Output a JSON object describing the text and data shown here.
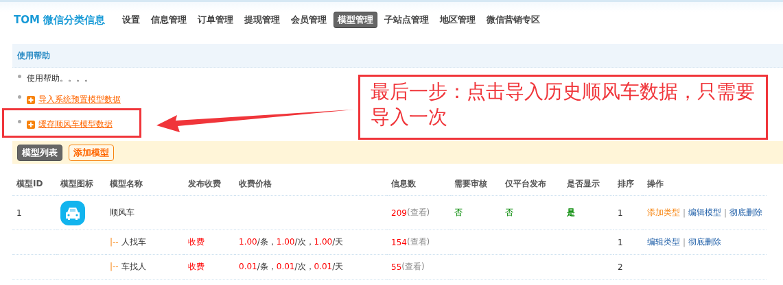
{
  "brand": "TOM 微信分类信息",
  "nav": [
    {
      "label": "设置",
      "selected": false
    },
    {
      "label": "信息管理",
      "selected": false
    },
    {
      "label": "订单管理",
      "selected": false
    },
    {
      "label": "提现管理",
      "selected": false
    },
    {
      "label": "会员管理",
      "selected": false
    },
    {
      "label": "模型管理",
      "selected": true
    },
    {
      "label": "子站点管理",
      "selected": false
    },
    {
      "label": "地区管理",
      "selected": false
    },
    {
      "label": "微信营销专区",
      "selected": false
    }
  ],
  "help": {
    "title": "使用帮助",
    "items": [
      {
        "kind": "text",
        "text": "使用帮助。。。。"
      },
      {
        "kind": "link",
        "text": "导入系统预置模型数据",
        "highlighted": false
      },
      {
        "kind": "link",
        "text": "缓存顺风车模型数据",
        "highlighted": true
      }
    ]
  },
  "annotation": {
    "text": "最后一步：点击导入历史顺风车数据，只需要导入一次"
  },
  "toolbar": [
    {
      "label": "模型列表",
      "selected": true
    },
    {
      "label": "添加模型",
      "selected": false
    }
  ],
  "table": {
    "columns": [
      "模型ID",
      "模型图标",
      "模型名称",
      "发布收费",
      "收费价格",
      "信息数",
      "需要审核",
      "仅平台发布",
      "是否显示",
      "排序",
      "操作"
    ],
    "rows": [
      {
        "kind": "model",
        "id": "1",
        "name": "顺风车",
        "action_separator": "|",
        "count": "209",
        "view": "(查看)",
        "review": "否",
        "platform_only": "否",
        "visible": "是",
        "sort": "1",
        "actions": [
          {
            "label": "添加类型",
            "kind": "add"
          },
          {
            "label": "编辑模型",
            "kind": "edit"
          },
          {
            "label": "彻底删除",
            "kind": "edit"
          }
        ]
      },
      {
        "kind": "type",
        "prefix": "|--",
        "name": "人找车",
        "action_separator": "|",
        "fee": "收费",
        "prices": [
          {
            "value": "1.00",
            "unit": "/条，"
          },
          {
            "value": "1.00",
            "unit": "/次，"
          },
          {
            "value": "1.00",
            "unit": "/天"
          }
        ],
        "count": "154",
        "view": "(查看)",
        "sort": "1",
        "actions": [
          {
            "label": "编辑类型",
            "kind": "edit"
          },
          {
            "label": "彻底删除",
            "kind": "edit"
          }
        ]
      },
      {
        "kind": "type",
        "prefix": "|--",
        "name": "车找人",
        "fee": "收费",
        "prices": [
          {
            "value": "0.01",
            "unit": "/条，"
          },
          {
            "value": "0.01",
            "unit": "/次，"
          },
          {
            "value": "0.01",
            "unit": "/天"
          }
        ],
        "count": "55",
        "view": "(查看)",
        "sort": "2"
      }
    ]
  }
}
